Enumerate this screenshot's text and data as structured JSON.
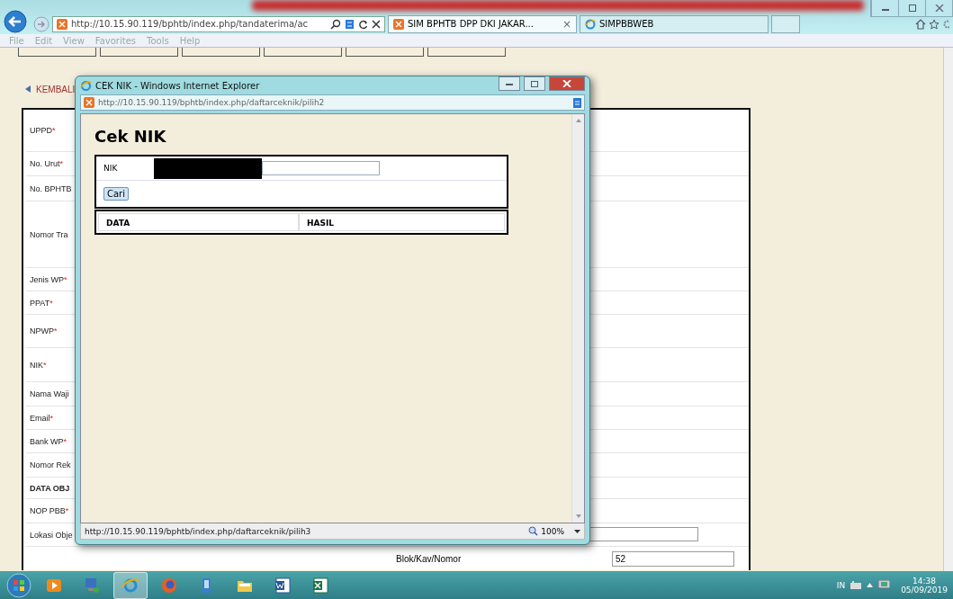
{
  "browser": {
    "address": "http://10.15.90.119/bphtb/index.php/tandaterima/ac",
    "tabs": [
      {
        "label": "SIM BPHTB DPP DKI JAKAR...",
        "selected": true,
        "close": "×"
      },
      {
        "label": "SIMPBBWEB",
        "selected": false
      }
    ],
    "menu": [
      "File",
      "Edit",
      "View",
      "Favorites",
      "Tools",
      "Help"
    ]
  },
  "page": {
    "back_link": "KEMBALI",
    "form_rows": [
      {
        "label": "UPPD",
        "required": "*"
      },
      {
        "label": "No. Urut",
        "required": "*"
      },
      {
        "label": "No. BPHTB"
      },
      {
        "label": "Nomor Tra"
      },
      {
        "label": "Jenis WP",
        "required": "*"
      },
      {
        "label": "PPAT",
        "required": "*"
      },
      {
        "label": "NPWP",
        "required": "*"
      },
      {
        "label": "NIK",
        "required": "*"
      },
      {
        "label": "Nama Waji"
      },
      {
        "label": "Email",
        "required": "*"
      },
      {
        "label": "Bank WP",
        "required": "*"
      },
      {
        "label": "Nomor Rek"
      },
      {
        "label": "DATA OBJ",
        "kind": "section"
      },
      {
        "label": "NOP PBB",
        "required": "*"
      },
      {
        "label": "Lokasi Obje",
        "field": true
      }
    ],
    "blok_row": {
      "label": "Blok/Kav/Nomor",
      "value": "52"
    }
  },
  "popup": {
    "title": "CEK NIK - Windows Internet Explorer",
    "address": "http://10.15.90.119/bphtb/index.php/daftarceknik/pilih2",
    "heading": "Cek NIK",
    "nik_label": "NIK",
    "search_button": "Cari",
    "columns": [
      "DATA",
      "HASIL"
    ],
    "status": "http://10.15.90.119/bphtb/index.php/daftarceknik/pilih3",
    "zoom": "100%"
  },
  "taskbar": {
    "apps": [
      {
        "kind": "media",
        "selected": false
      },
      {
        "kind": "network",
        "selected": false
      },
      {
        "kind": "ie",
        "selected": true
      },
      {
        "kind": "firefox",
        "selected": false
      },
      {
        "kind": "device",
        "selected": false
      },
      {
        "kind": "folder",
        "selected": false
      },
      {
        "kind": "word",
        "selected": false
      },
      {
        "kind": "excel",
        "selected": false
      }
    ],
    "language": "IN",
    "time": "14:38",
    "date": "05/09/2019"
  }
}
